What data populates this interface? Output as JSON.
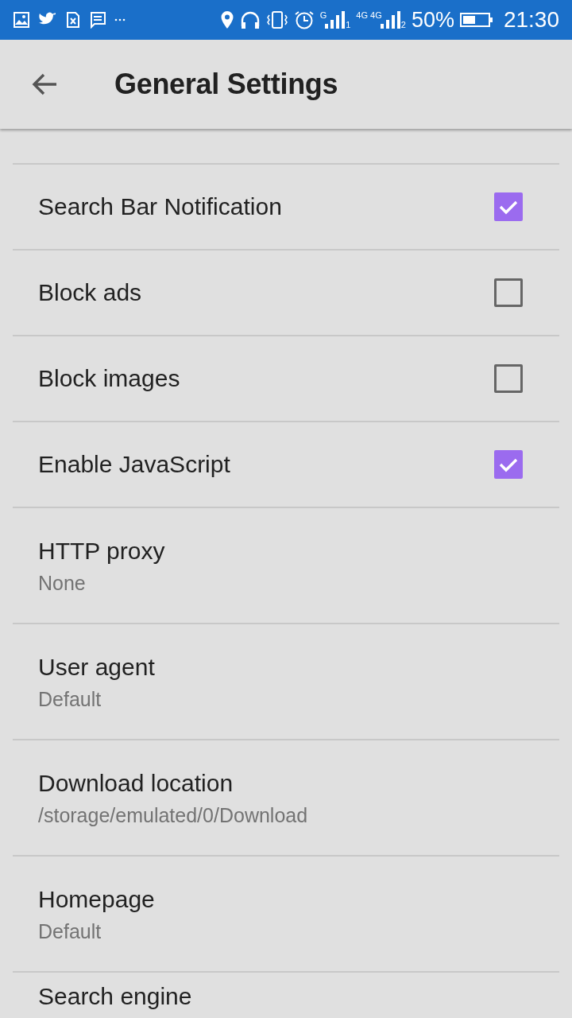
{
  "status_bar": {
    "sim_1": {
      "network": "G",
      "slot": "1"
    },
    "sim_2": {
      "network": "4G 4G",
      "slot": "2"
    },
    "battery": "50%",
    "time": "21:30"
  },
  "app_bar": {
    "title": "General Settings"
  },
  "settings": [
    {
      "kind": "checkbox",
      "title": "Search Bar Notification",
      "checked": true
    },
    {
      "kind": "checkbox",
      "title": "Block ads",
      "checked": false
    },
    {
      "kind": "checkbox",
      "title": "Block images",
      "checked": false
    },
    {
      "kind": "checkbox",
      "title": "Enable JavaScript",
      "checked": true
    },
    {
      "kind": "text",
      "title": "HTTP proxy",
      "summary": "None"
    },
    {
      "kind": "text",
      "title": "User agent",
      "summary": "Default"
    },
    {
      "kind": "text",
      "title": "Download location",
      "summary": "/storage/emulated/0/Download"
    },
    {
      "kind": "text",
      "title": "Homepage",
      "summary": "Default"
    },
    {
      "kind": "text",
      "title": "Search engine"
    }
  ]
}
